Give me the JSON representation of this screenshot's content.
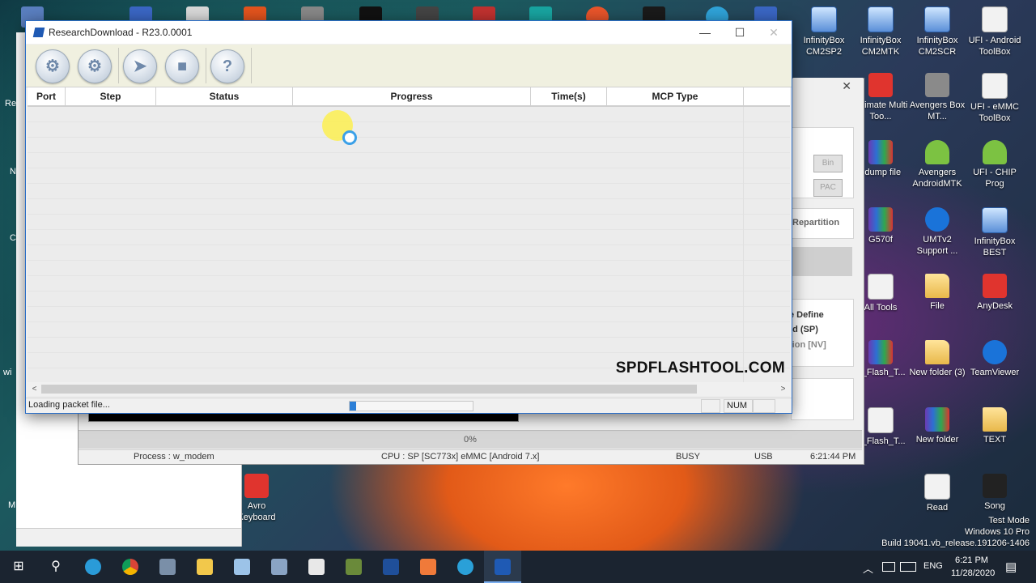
{
  "main_window": {
    "title": "ResearchDownload - R23.0.0001",
    "controls": {
      "minimize": "—",
      "maximize": "☐",
      "close": "✕"
    },
    "toolbar": [
      {
        "name": "settings",
        "glyph": "⚙"
      },
      {
        "name": "packet",
        "glyph": "⚙"
      },
      {
        "name": "start",
        "glyph": "➤"
      },
      {
        "name": "stop",
        "glyph": "■"
      },
      {
        "name": "help",
        "glyph": "?"
      }
    ],
    "columns": [
      "Port",
      "Step",
      "Status",
      "Progress",
      "Time(s)",
      "MCP Type"
    ],
    "watermark": "SPDFLASHTOOL.COM",
    "status_text": "Loading packet file...",
    "num_indicator": "NUM",
    "scroll_left": "<",
    "scroll_right": ">"
  },
  "back_window": {
    "bin_button": "Bin",
    "pac_button": "PAC",
    "repartition": "Repartition",
    "define_lines": [
      "e Define",
      "ild (SP)",
      "tion [NV]"
    ],
    "progress_text": "0%",
    "status_bar": {
      "process": "Process : w_modem",
      "cpu": "CPU : SP [SC773x] eMMC [Android 7.x]",
      "state": "BUSY",
      "conn": "USB",
      "time": "6:21:44 PM"
    }
  },
  "left_edge_labels": [
    "Re",
    "N",
    "C",
    "wi",
    "M"
  ],
  "desktop_icons": [
    {
      "label": "InfinityBox CM2SP2",
      "type": "pc"
    },
    {
      "label": "InfinityBox CM2MTK",
      "type": "pc"
    },
    {
      "label": "InfinityBox CM2SCR",
      "type": "pc"
    },
    {
      "label": "UFI - Android ToolBox",
      "type": "doc"
    },
    {
      "label": "Ultimate Multi Too...",
      "type": "red"
    },
    {
      "label": "Avengers Box MT...",
      "type": "gray"
    },
    {
      "label": "UFI - eMMC ToolBox",
      "type": "doc"
    },
    {
      "label": "l dump file",
      "type": "rar"
    },
    {
      "label": "Avengers AndroidMTK",
      "type": "android"
    },
    {
      "label": "UFI - CHIP Prog",
      "type": "android"
    },
    {
      "label": "G570f",
      "type": "rar"
    },
    {
      "label": "UMTv2 Support ...",
      "type": "blue"
    },
    {
      "label": "InfinityBox BEST",
      "type": "pc"
    },
    {
      "label": "All Tools",
      "type": "doc"
    },
    {
      "label": "File",
      "type": "folder"
    },
    {
      "label": "AnyDesk",
      "type": "red"
    },
    {
      "label": "P_Flash_T...",
      "type": "rar"
    },
    {
      "label": "New folder (3)",
      "type": "folder"
    },
    {
      "label": "TeamViewer",
      "type": "blue"
    },
    {
      "label": "P_Flash_T...",
      "type": "doc"
    },
    {
      "label": "New folder",
      "type": "rar"
    },
    {
      "label": "TEXT",
      "type": "folder"
    },
    {
      "label": "Avro Keyboard",
      "type": "red"
    },
    {
      "label": "Read",
      "type": "doc"
    },
    {
      "label": "Song",
      "type": "dark"
    }
  ],
  "watermark_os": {
    "line1": "Test Mode",
    "line2": "Windows 10 Pro",
    "line3": "Build 19041.vb_release.191206-1406"
  },
  "taskbar": {
    "start_glyph": "⊞",
    "search_glyph": "⚲",
    "tray_arrow": "︿",
    "lang": "ENG",
    "time": "6:21 PM",
    "date": "11/28/2020",
    "notification_glyph": "▤"
  },
  "colors": {
    "accent": "#2c6fc7",
    "progress": "#2c7fd7",
    "taskbar": "#1b2430"
  }
}
